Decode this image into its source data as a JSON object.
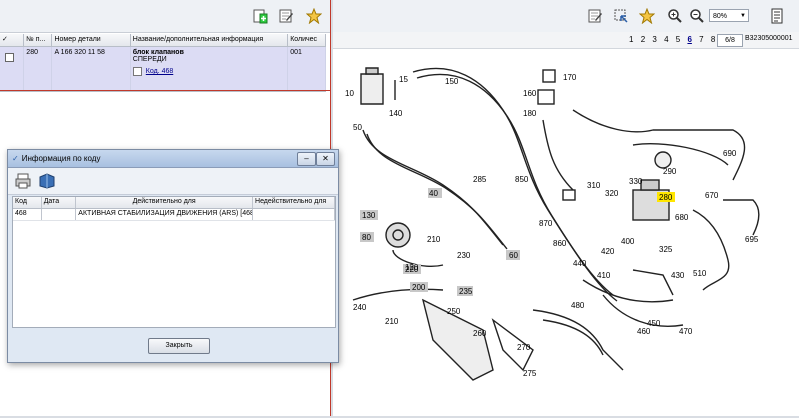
{
  "left": {
    "columns": [
      "✓",
      "№ п...",
      "Номер детали",
      "Название/дополнительная информация",
      "Количес"
    ],
    "rows": [
      {
        "pos": "280",
        "part": "A 166 320 11 58",
        "name": "блок клапанов",
        "sub": "СПЕРЕДИ",
        "code_link": "Код. 468",
        "qty": "001"
      }
    ]
  },
  "right": {
    "zoom": "80%",
    "pages": [
      "1",
      "2",
      "3",
      "4",
      "5",
      "6",
      "7",
      "8"
    ],
    "current_page": "6",
    "page_box": "6/8",
    "diagram_code": "B32305000001"
  },
  "dialog": {
    "title": "Информация по коду",
    "columns": [
      "Код",
      "Дата",
      "Действительно для",
      "Недействительно для"
    ],
    "rows": [
      {
        "code": "468",
        "date": "",
        "valid": "АКТИВНАЯ СТАБИЛИЗАЦИЯ ДВИЖЕНИЯ (ARS) [468]",
        "invalid": ""
      }
    ],
    "close_label": "Закрыть"
  },
  "diagram": {
    "labels": [
      "15",
      "10",
      "150",
      "170",
      "160",
      "180",
      "50",
      "140",
      "40",
      "285",
      "850",
      "310",
      "320",
      "330",
      "290",
      "280",
      "690",
      "670",
      "680",
      "695",
      "130",
      "80",
      "210",
      "230",
      "220",
      "60",
      "120",
      "200",
      "235",
      "870",
      "860",
      "440",
      "410",
      "420",
      "400",
      "430",
      "510",
      "240",
      "210",
      "250",
      "260",
      "270",
      "275",
      "480",
      "460",
      "450",
      "470",
      "325"
    ]
  },
  "colors": {
    "selected_row": "#dcdcf4",
    "highlight": "#ffe600",
    "label_box": "#c8c8c8"
  }
}
